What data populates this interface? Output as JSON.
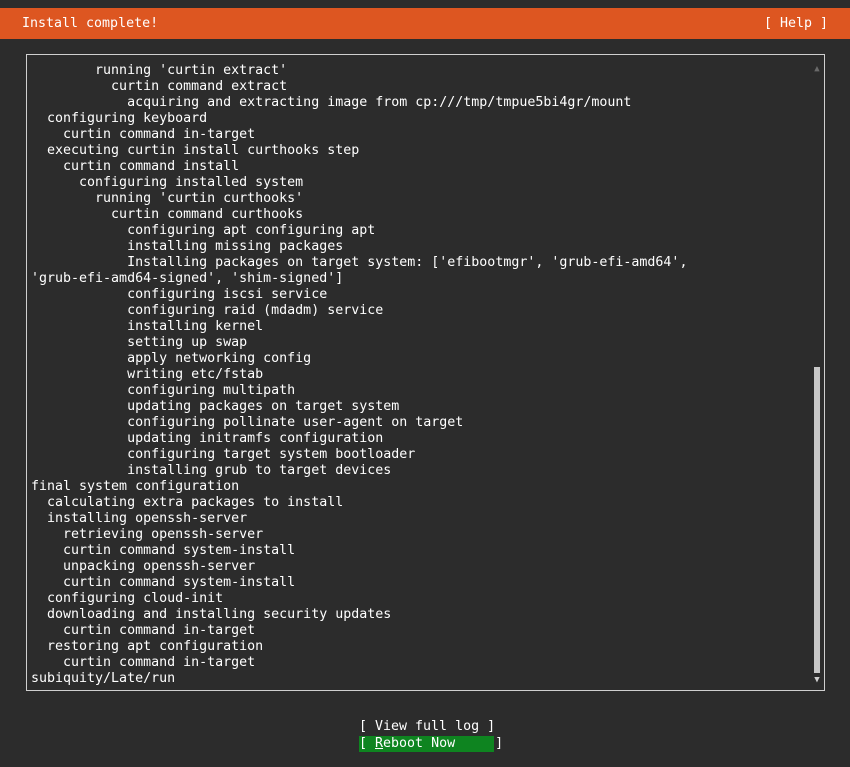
{
  "header": {
    "title": "Install complete!",
    "help_label": "[ Help ]"
  },
  "log": {
    "lines": [
      "        running 'curtin extract'",
      "          curtin command extract",
      "            acquiring and extracting image from cp:///tmp/tmpue5bi4gr/mount",
      "  configuring keyboard",
      "    curtin command in-target",
      "  executing curtin install curthooks step",
      "    curtin command install",
      "      configuring installed system",
      "        running 'curtin curthooks'",
      "          curtin command curthooks",
      "            configuring apt configuring apt",
      "            installing missing packages",
      "            Installing packages on target system: ['efibootmgr', 'grub-efi-amd64',",
      "'grub-efi-amd64-signed', 'shim-signed']",
      "            configuring iscsi service",
      "            configuring raid (mdadm) service",
      "            installing kernel",
      "            setting up swap",
      "            apply networking config",
      "            writing etc/fstab",
      "            configuring multipath",
      "            updating packages on target system",
      "            configuring pollinate user-agent on target",
      "            updating initramfs configuration",
      "            configuring target system bootloader",
      "            installing grub to target devices",
      "final system configuration",
      "  calculating extra packages to install",
      "  installing openssh-server",
      "    retrieving openssh-server",
      "    curtin command system-install",
      "    unpacking openssh-server",
      "    curtin command system-install",
      "  configuring cloud-init",
      "  downloading and installing security updates",
      "    curtin command in-target",
      "  restoring apt configuration",
      "    curtin command in-target",
      "subiquity/Late/run"
    ]
  },
  "buttons": {
    "view_log_label": "[ View full log ]",
    "reboot_open": "[ ",
    "reboot_hotkey": "R",
    "reboot_rest": "eboot Now     ]"
  },
  "icons": {
    "scroll_up": "scroll-up-arrow",
    "scroll_down": "scroll-down-arrow"
  },
  "colors": {
    "title_bar": "#dd5621",
    "background": "#2c2c2c",
    "reboot_button": "#0e8420"
  }
}
